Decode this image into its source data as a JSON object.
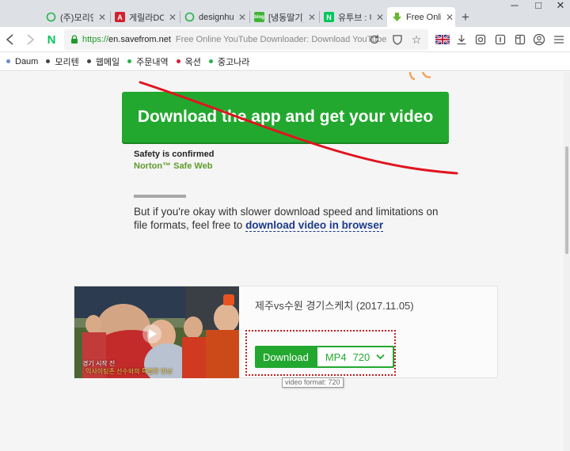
{
  "tabs": [
    {
      "title": "(주)모리안",
      "icon": "ring-icon",
      "color": "#26b34a"
    },
    {
      "title": "게릴라DC|",
      "icon": "gallery-icon",
      "color": "#d22030"
    },
    {
      "title": "designhug",
      "icon": "ring-icon",
      "color": "#26b34a"
    },
    {
      "title": "[냉동딸기]",
      "icon": "blog-icon",
      "color": "#3fb535"
    },
    {
      "title": "유투브 : 네",
      "icon": "naver-icon",
      "color": "#03c75a"
    },
    {
      "title": "Free Onlin",
      "icon": "download-arrow-icon",
      "color": "#65b82d"
    }
  ],
  "window": {
    "minimize": "─",
    "maximize": "□",
    "close": "✕",
    "new_tab": "+"
  },
  "address": {
    "scheme": "https://",
    "host": "en.savefrom.net",
    "page_title": "Free Online YouTube Downloader: Download YouTube"
  },
  "bookmarks": [
    {
      "label": "Daum",
      "color": "#6b8cc7"
    },
    {
      "label": "모리텐",
      "color": "#444444"
    },
    {
      "label": "웹메일",
      "color": "#444444"
    },
    {
      "label": "주문내역",
      "color": "#26b34a"
    },
    {
      "label": "옥션",
      "color": "#d22030"
    },
    {
      "label": "중고나라",
      "color": "#26b34a"
    }
  ],
  "main": {
    "cta_label": "Download the app and get your video",
    "safety": "Safety is confirmed",
    "norton": "Norton™ Safe Web",
    "slow_text": "But if you're okay with slower download speed and limitations on file formats, feel free to ",
    "slow_link": "download video in browser"
  },
  "video": {
    "title": "제주vs수원 경기스케치 (2017.11.05)",
    "download_label": "Download",
    "format": "MP4",
    "quality": "720",
    "tooltip": "video format: 720",
    "thumb_caption_1": "경기 시작 전",
    "thumb_caption_2": "익사이팅존 선수와의 특별한 만남"
  },
  "colors": {
    "accent": "#23a82f",
    "annotation_red": "#e0141e"
  }
}
